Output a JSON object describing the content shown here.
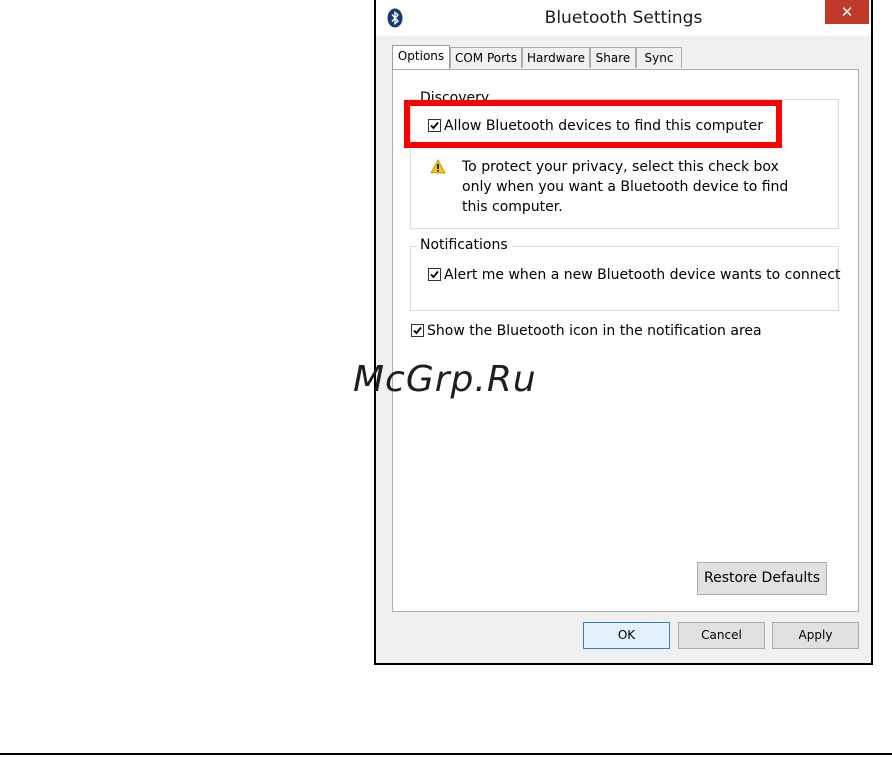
{
  "window": {
    "title": "Bluetooth Settings",
    "close_label": "✕"
  },
  "tabs": [
    {
      "label": "Options",
      "active": true
    },
    {
      "label": "COM Ports",
      "active": false
    },
    {
      "label": "Hardware",
      "active": false
    },
    {
      "label": "Share",
      "active": false
    },
    {
      "label": "Sync",
      "active": false
    }
  ],
  "discovery": {
    "group_label": "Discovery",
    "allow_label": "Allow Bluetooth devices to find this computer",
    "allow_checked": true,
    "warning_text": "To protect your privacy, select this check box only when you want a Bluetooth device to find this computer."
  },
  "notifications": {
    "group_label": "Notifications",
    "alert_label": "Alert me when a new Bluetooth device wants to connect",
    "alert_checked": true
  },
  "show_icon": {
    "label": "Show the Bluetooth icon in the notification area",
    "checked": true
  },
  "buttons": {
    "restore_defaults": "Restore Defaults",
    "ok": "OK",
    "cancel": "Cancel",
    "apply": "Apply"
  },
  "watermark": "McGrp.Ru",
  "colors": {
    "highlight": "#ff0000",
    "close_button": "#c0392b",
    "bluetooth_icon": "#1a3a6b",
    "warning_icon": "#f5c518"
  }
}
